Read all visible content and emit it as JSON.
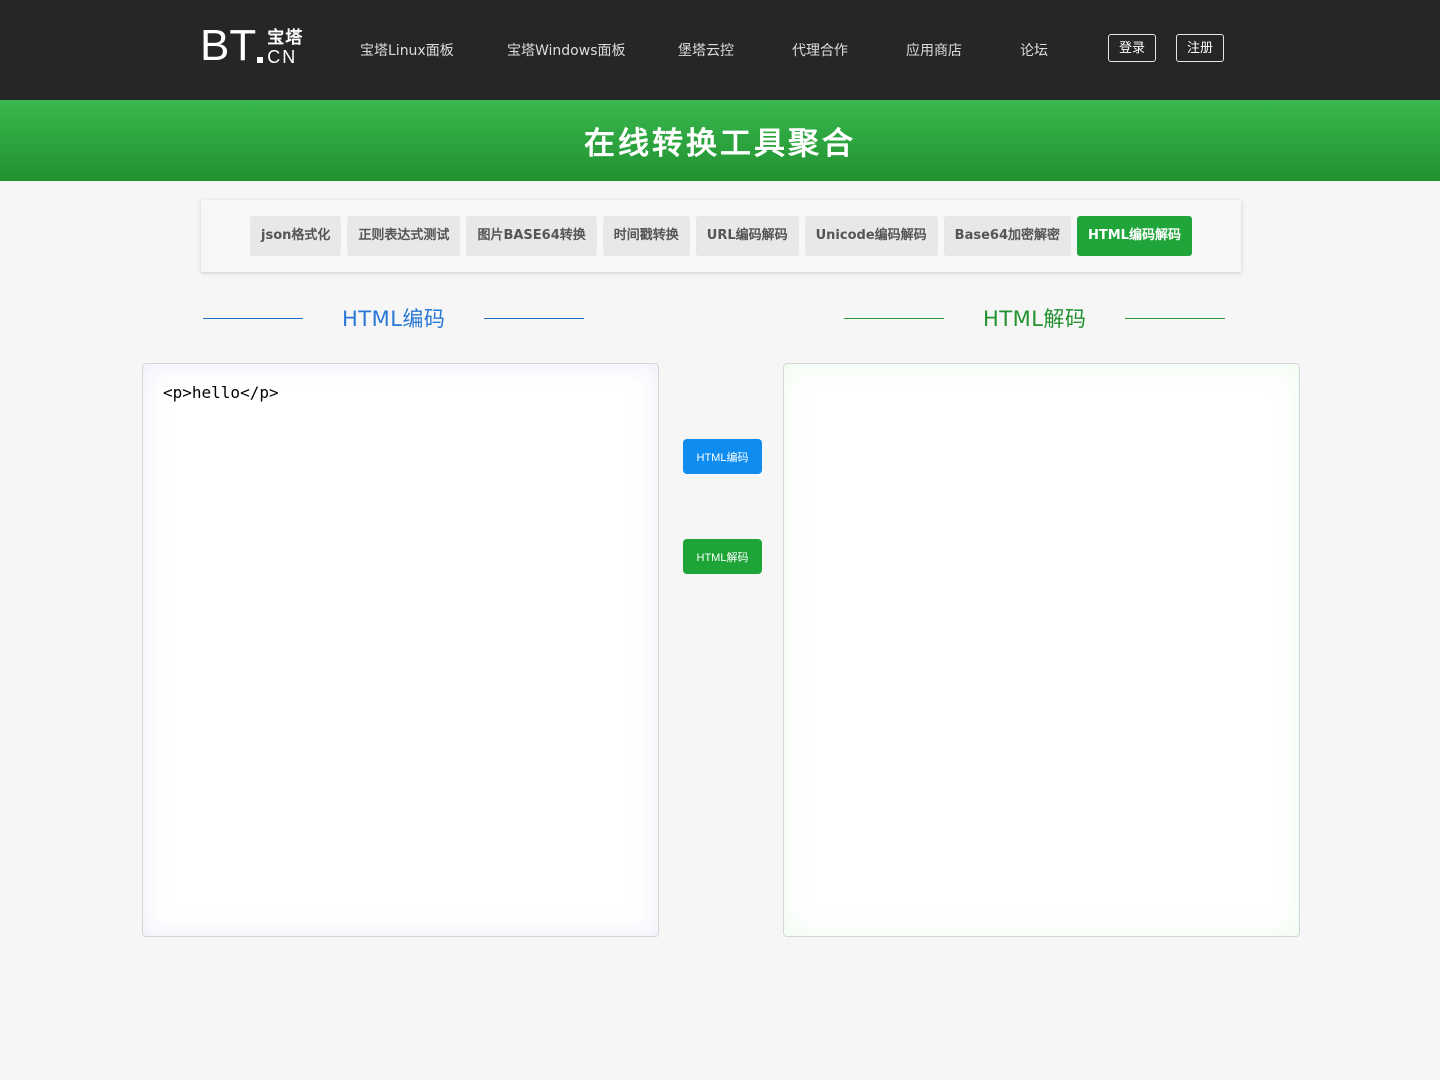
{
  "header": {
    "logo": {
      "main": "BT",
      "chars": "宝塔",
      "latin": "CN"
    },
    "nav": [
      {
        "label": "宝塔Linux面板"
      },
      {
        "label": "宝塔Windows面板"
      },
      {
        "label": "堡塔云控"
      },
      {
        "label": "代理合作"
      },
      {
        "label": "应用商店"
      },
      {
        "label": "论坛"
      }
    ],
    "login_label": "登录",
    "register_label": "注册"
  },
  "banner": {
    "title": "在线转换工具聚合"
  },
  "tools": {
    "tabs": [
      {
        "label": "json格式化",
        "active": false
      },
      {
        "label": "正则表达式测试",
        "active": false
      },
      {
        "label": "图片BASE64转换",
        "active": false
      },
      {
        "label": "时间戳转换",
        "active": false
      },
      {
        "label": "URL编码解码",
        "active": false
      },
      {
        "label": "Unicode编码解码",
        "active": false
      },
      {
        "label": "Base64加密解密",
        "active": false
      },
      {
        "label": "HTML编码解码",
        "active": true
      }
    ]
  },
  "encode_section": {
    "title": "HTML编码",
    "input_value": "<p>hello</p>"
  },
  "decode_section": {
    "title": "HTML解码",
    "output_value": ""
  },
  "actions": {
    "encode_label": "HTML编码",
    "decode_label": "HTML解码"
  },
  "colors": {
    "header_bg": "#262626",
    "brand_green": "#20a53a",
    "encode_blue": "#0f8cf0",
    "decode_green": "#1ea538"
  }
}
